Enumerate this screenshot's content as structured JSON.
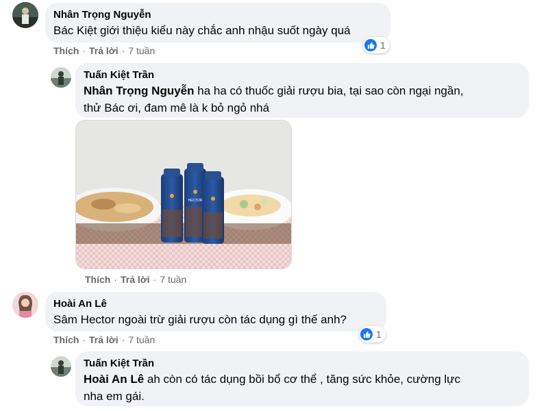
{
  "comments": [
    {
      "author": "Nhân Trọng Nguyễn",
      "text": "Bác Kiệt giới thiệu kiểu này chắc anh nhậu suốt ngày quá",
      "actions": {
        "like": "Thích",
        "reply": "Trả lời",
        "time": "7 tuần"
      },
      "reactions": "1",
      "reaction_icon": "like-icon"
    },
    {
      "author": "Tuấn Kiệt Trần",
      "mention": "Nhân Trọng Nguyễn",
      "text_line1": "ha ha có thuốc giải rượu bia, tại sao còn ngại ngần,",
      "text_line2": "thử Bác ơi, đam mê là k bỏ ngỏ nhá",
      "actions": {
        "like": "Thích",
        "reply": "Trả lời",
        "time": "7 tuần"
      },
      "attachment": "product-photo"
    },
    {
      "author": "Hoài An Lê",
      "text": "Sâm Hector ngoài trừ giải rượu còn tác dụng gì thế anh?",
      "actions": {
        "like": "Thích",
        "reply": "Trả lời",
        "time": "7 tuần"
      },
      "reactions": "1",
      "reaction_icon": "like-icon"
    },
    {
      "author": "Tuấn Kiệt Trần",
      "mention": "Hoài An Lê",
      "text_line1": "ah còn có tác dụng bồi bổ cơ thể , tăng sức khỏe, cường lực",
      "text_line2": "nha em gái."
    }
  ],
  "photo_label": "HECTOR",
  "colors": {
    "bubble": "#f0f2f5",
    "meta": "#65676b",
    "like": "#1877f2"
  }
}
